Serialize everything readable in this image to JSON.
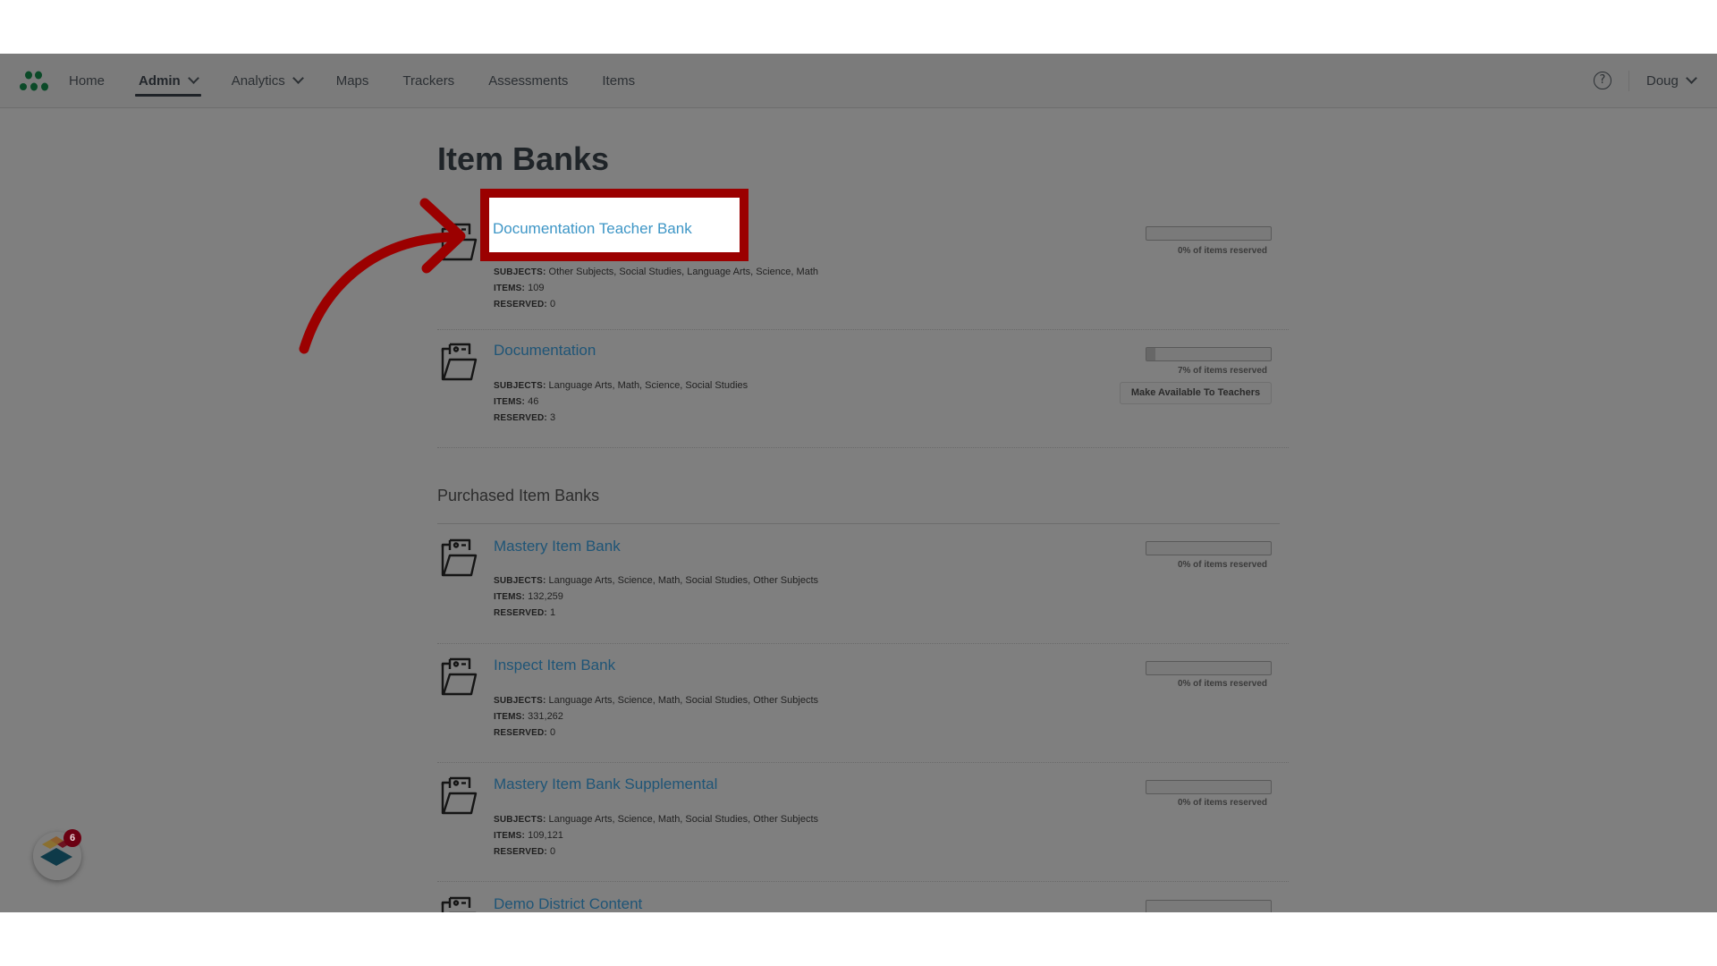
{
  "header": {
    "nav": [
      {
        "label": "Home",
        "dropdown": false,
        "active": false
      },
      {
        "label": "Admin",
        "dropdown": true,
        "active": true
      },
      {
        "label": "Analytics",
        "dropdown": true,
        "active": false
      },
      {
        "label": "Maps",
        "dropdown": false,
        "active": false
      },
      {
        "label": "Trackers",
        "dropdown": false,
        "active": false
      },
      {
        "label": "Assessments",
        "dropdown": false,
        "active": false
      },
      {
        "label": "Items",
        "dropdown": false,
        "active": false
      }
    ],
    "help_icon": "question-circle-icon",
    "help_glyph": "?",
    "user_label": "Doug"
  },
  "page": {
    "title": "Item Banks",
    "labels": {
      "subjects": "SUBJECTS:",
      "items": "ITEMS:",
      "reserved": "RESERVED:"
    },
    "own_banks": [
      {
        "name": "Documentation Teacher Bank",
        "subjects": "Other Subjects, Social Studies, Language Arts, Science, Math",
        "items": "109",
        "reserved": "0",
        "reserved_percent": 0,
        "reserved_label": "0% of items reserved",
        "highlighted": true
      },
      {
        "name": "Documentation",
        "subjects": "Language Arts, Math, Science, Social Studies",
        "items": "46",
        "reserved": "3",
        "reserved_percent": 7,
        "reserved_label": "7% of items reserved",
        "action_label": "Make Available To Teachers"
      }
    ],
    "purchased_title": "Purchased Item Banks",
    "purchased_banks": [
      {
        "name": "Mastery Item Bank",
        "subjects": "Language Arts, Science, Math, Social Studies, Other Subjects",
        "items": "132,259",
        "reserved": "1",
        "reserved_percent": 0,
        "reserved_label": "0% of items reserved"
      },
      {
        "name": "Inspect Item Bank",
        "subjects": "Language Arts, Science, Math, Social Studies, Other Subjects",
        "items": "331,262",
        "reserved": "0",
        "reserved_percent": 0,
        "reserved_label": "0% of items reserved"
      },
      {
        "name": "Mastery Item Bank Supplemental",
        "subjects": "Language Arts, Science, Math, Social Studies, Other Subjects",
        "items": "109,121",
        "reserved": "0",
        "reserved_percent": 0,
        "reserved_label": "0% of items reserved"
      },
      {
        "name": "Demo District Content",
        "reserved_percent": 0
      }
    ]
  },
  "widget": {
    "badge_count": "6"
  },
  "colors": {
    "annotation_red": "#9b0000",
    "link_blue": "#3e96c6",
    "logo_green": "#0b5a30"
  }
}
